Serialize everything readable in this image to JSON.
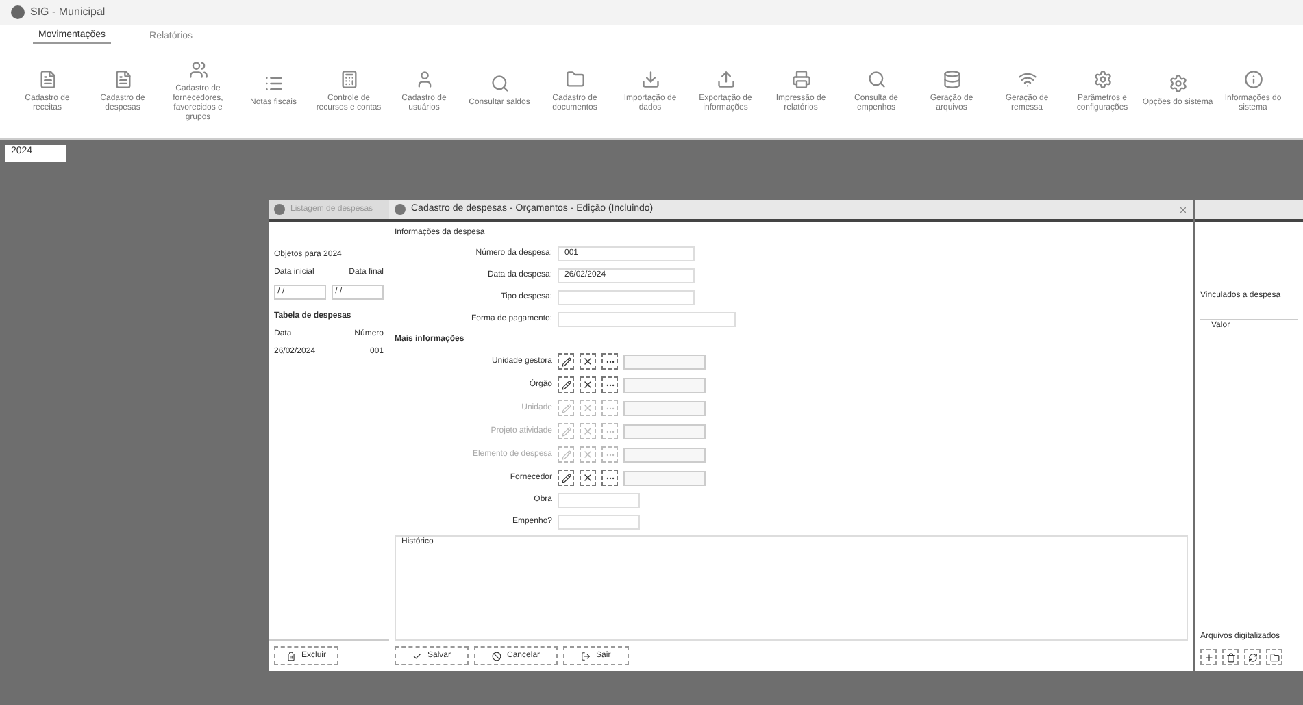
{
  "app_title": "SIG - Municipal",
  "menu_tabs": [
    {
      "label": "Movimentações",
      "selected": true
    },
    {
      "label": "Relatórios",
      "selected": false
    }
  ],
  "toolbar": [
    {
      "label": "Cadastro de receitas"
    },
    {
      "label": "Cadastro de despesas"
    },
    {
      "label": "Cadastro de fornecedores, favorecidos e grupos"
    },
    {
      "label": "Notas fiscais"
    },
    {
      "label": "Controle de recursos e contas"
    },
    {
      "label": "Cadastro de usuários"
    },
    {
      "label": "Consultar saldos"
    },
    {
      "label": "Cadastro de documentos"
    },
    {
      "label": "Importação de dados"
    },
    {
      "label": "Exportação de informações"
    },
    {
      "label": "Impressão de relatórios"
    },
    {
      "label": "Consulta de empenhos"
    },
    {
      "label": "Geração de arquivos"
    },
    {
      "label": "Geração de remessa"
    },
    {
      "label": "Parâmetros e configurações"
    },
    {
      "label": "Opções do sistema"
    },
    {
      "label": "Informações do sistema"
    }
  ],
  "year_tab": "2024",
  "left_panel": {
    "tab": "Listagem de despesas",
    "period_label": "Objetos para 2024",
    "start_label": "Data inicial",
    "end_label": "Data final",
    "start_value": " / / ",
    "end_value": " / / ",
    "table_title": "Tabela de despesas",
    "columns": [
      "Data",
      "Número"
    ],
    "rows": [
      [
        "26/02/2024",
        "001"
      ]
    ],
    "delete_button": "Excluir"
  },
  "dialog": {
    "title": "Cadastro de despesas - Orçamentos - Edição (Incluindo)",
    "section": "Informações da despesa",
    "fields": [
      {
        "label": "Número da despesa:",
        "value": "001"
      },
      {
        "label": "Data da despesa:",
        "value": "26/02/2024"
      },
      {
        "label": "Tipo despesa:"
      },
      {
        "label": "Forma de pagamento:"
      }
    ],
    "more_section": "Mais informações",
    "lookups": [
      {
        "label": "Unidade gestora",
        "enabled": true
      },
      {
        "label": "Órgão",
        "enabled": true
      },
      {
        "label": "Unidade",
        "enabled": false
      },
      {
        "label": "Projeto atividade",
        "enabled": false
      },
      {
        "label": "Elemento de despesa",
        "enabled": false
      },
      {
        "label": "Fornecedor",
        "enabled": true
      }
    ],
    "extra_fields": [
      {
        "label": "Obra"
      },
      {
        "label": "Empenho?"
      }
    ],
    "history_label": "Histórico",
    "buttons": [
      "Salvar",
      "Cancelar",
      "Sair"
    ]
  },
  "right_panel": {
    "label": "Vinculados a despesa",
    "column": "Valor",
    "footer": "Arquivos digitalizados"
  }
}
